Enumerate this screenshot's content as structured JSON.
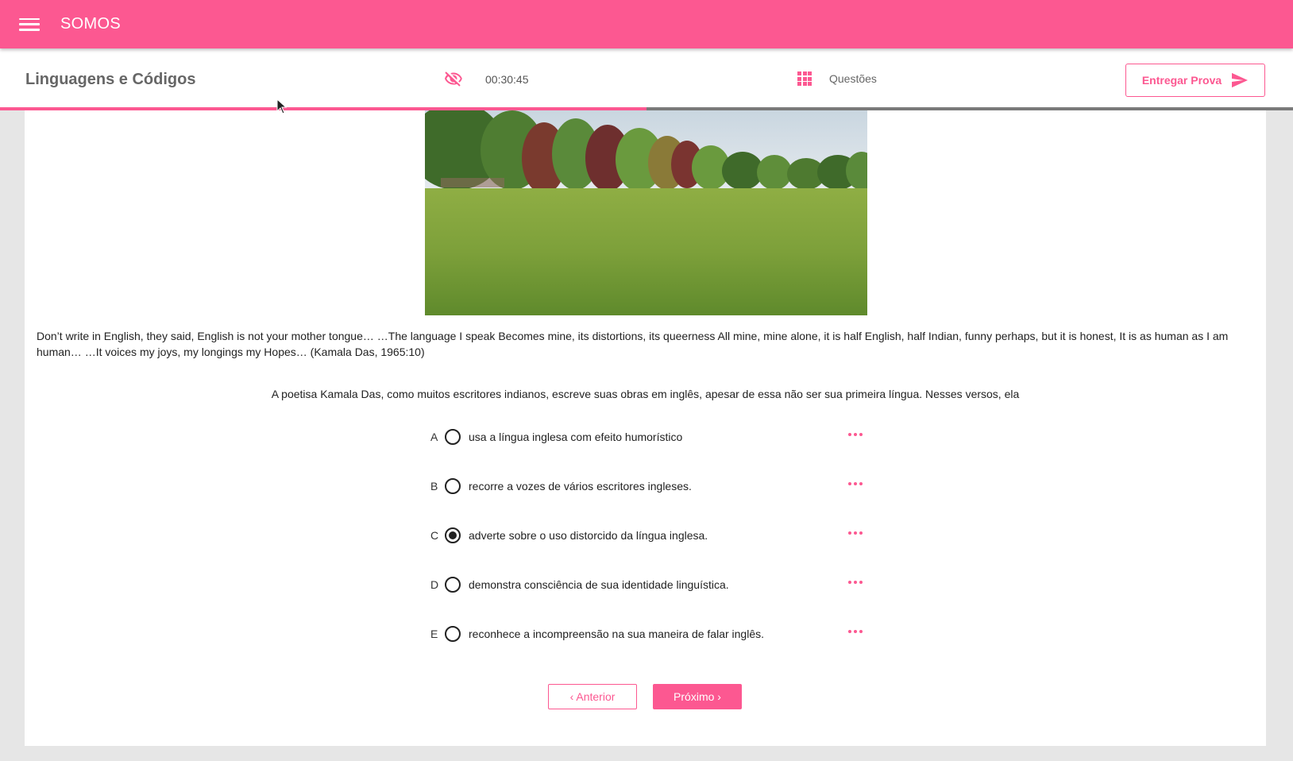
{
  "app": {
    "brand": "SOMOS"
  },
  "header": {
    "subject": "Linguagens e Códigos",
    "timer": "00:30:45",
    "questions_label": "Questões",
    "submit_label": "Entregar Prova",
    "progress_fraction": 0.5
  },
  "colors": {
    "accent": "#fc5891",
    "progress_track": "#7a7a7a"
  },
  "question": {
    "passage": "Don’t write in English, they said, English is not your mother tongue… …The language I speak Becomes mine, its distortions, its queerness All mine, mine alone, it is half English, half Indian, funny perhaps, but it is honest, It is as human as I am human… …It voices my joys, my longings my Hopes… (Kamala Das, 1965:10)",
    "stem": "A poetisa Kamala Das, como muitos escritores indianos, escreve suas obras em inglês, apesar de essa não ser sua primeira língua. Nesses versos, ela",
    "options": [
      {
        "letter": "A",
        "text": "usa a língua inglesa com efeito humorístico",
        "selected": false
      },
      {
        "letter": "B",
        "text": "recorre a vozes de vários escritores ingleses.",
        "selected": false
      },
      {
        "letter": "C",
        "text": "adverte sobre o uso distorcido da língua inglesa.",
        "selected": true
      },
      {
        "letter": "D",
        "text": "demonstra consciência de sua identidade linguística.",
        "selected": false
      },
      {
        "letter": "E",
        "text": "reconhece a incompreensão na sua maneira de falar inglês.",
        "selected": false
      }
    ]
  },
  "nav": {
    "prev_label": "‹ Anterior",
    "next_label": "Próximo ›"
  },
  "icons": {
    "menu": "menu-icon",
    "visibility": "eye-off-icon",
    "grid": "grid-icon",
    "send": "send-icon",
    "more": "more-horiz-icon"
  }
}
